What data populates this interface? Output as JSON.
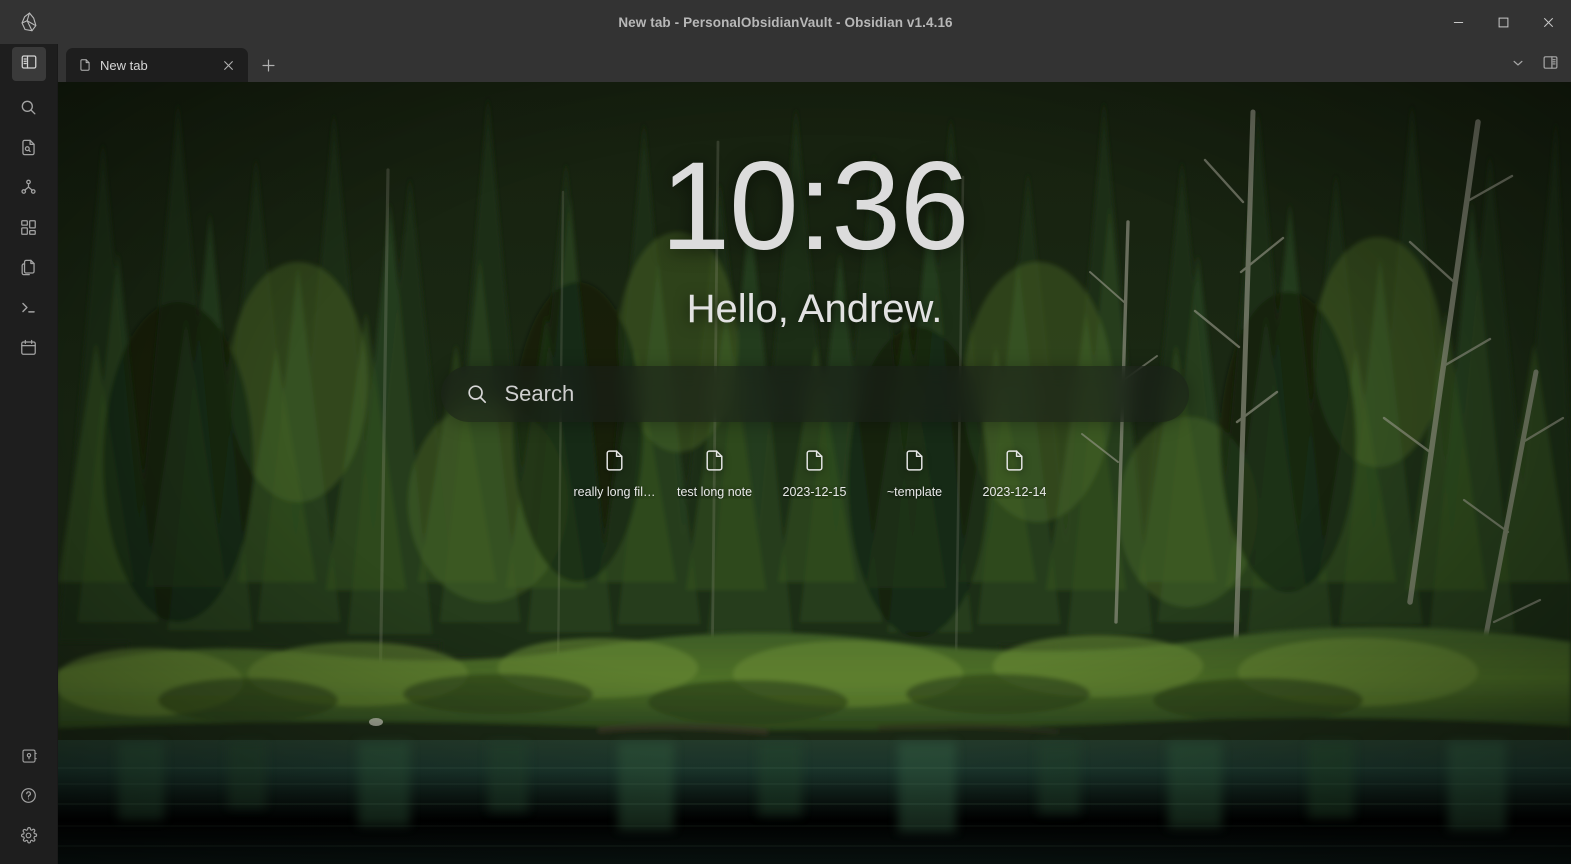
{
  "window": {
    "title": "New tab - PersonalObsidianVault - Obsidian v1.4.16",
    "app_name": "Obsidian",
    "vault_name": "PersonalObsidianVault",
    "version": "v1.4.16",
    "controls": {
      "minimize": "—",
      "maximize": "☐",
      "close": "✕"
    }
  },
  "ribbon": {
    "logo": "obsidian-logo-icon",
    "top_items": [
      {
        "name": "toggle-left-sidebar",
        "icon": "sidebar-left-icon",
        "active": true
      },
      {
        "name": "quick-switcher-search",
        "icon": "search-icon",
        "active": false
      },
      {
        "name": "search-in-file",
        "icon": "file-search-icon",
        "active": false
      },
      {
        "name": "graph-view",
        "icon": "graph-icon",
        "active": false
      },
      {
        "name": "canvas",
        "icon": "canvas-grid-icon",
        "active": false
      },
      {
        "name": "open-another-file",
        "icon": "copy-files-icon",
        "active": false
      },
      {
        "name": "terminal",
        "icon": "terminal-icon",
        "active": false
      },
      {
        "name": "daily-note-calendar",
        "icon": "calendar-icon",
        "active": false
      }
    ],
    "bottom_items": [
      {
        "name": "open-vault",
        "icon": "vault-icon"
      },
      {
        "name": "help",
        "icon": "help-question-icon"
      },
      {
        "name": "settings",
        "icon": "gear-icon"
      }
    ]
  },
  "tabbar": {
    "tabs": [
      {
        "label": "New tab",
        "icon": "file-icon",
        "close_label": "✕",
        "active": true
      }
    ],
    "new_tab_label": "+",
    "right_actions": [
      {
        "name": "tab-list-dropdown",
        "icon": "chevron-down-icon"
      },
      {
        "name": "toggle-right-sidebar",
        "icon": "sidebar-right-icon"
      }
    ]
  },
  "newtab": {
    "clock": "10:36",
    "greeting": "Hello, Andrew.",
    "search": {
      "placeholder": "Search",
      "value": "",
      "icon": "search-icon"
    },
    "shortcuts": [
      {
        "label": "really long fil…",
        "icon": "file-icon"
      },
      {
        "label": "test long note",
        "icon": "file-icon"
      },
      {
        "label": "2023-12-15",
        "icon": "file-icon"
      },
      {
        "label": "~template",
        "icon": "file-icon"
      },
      {
        "label": "2023-12-14",
        "icon": "file-icon"
      }
    ]
  },
  "theme": {
    "titlebar_bg": "#333333",
    "ribbon_bg": "#1e1e1e",
    "tab_active_bg": "#1e1e1e",
    "text_primary": "#dcdcdc",
    "text_muted": "#a3a3a3",
    "close_hover": "#c42b1c"
  }
}
